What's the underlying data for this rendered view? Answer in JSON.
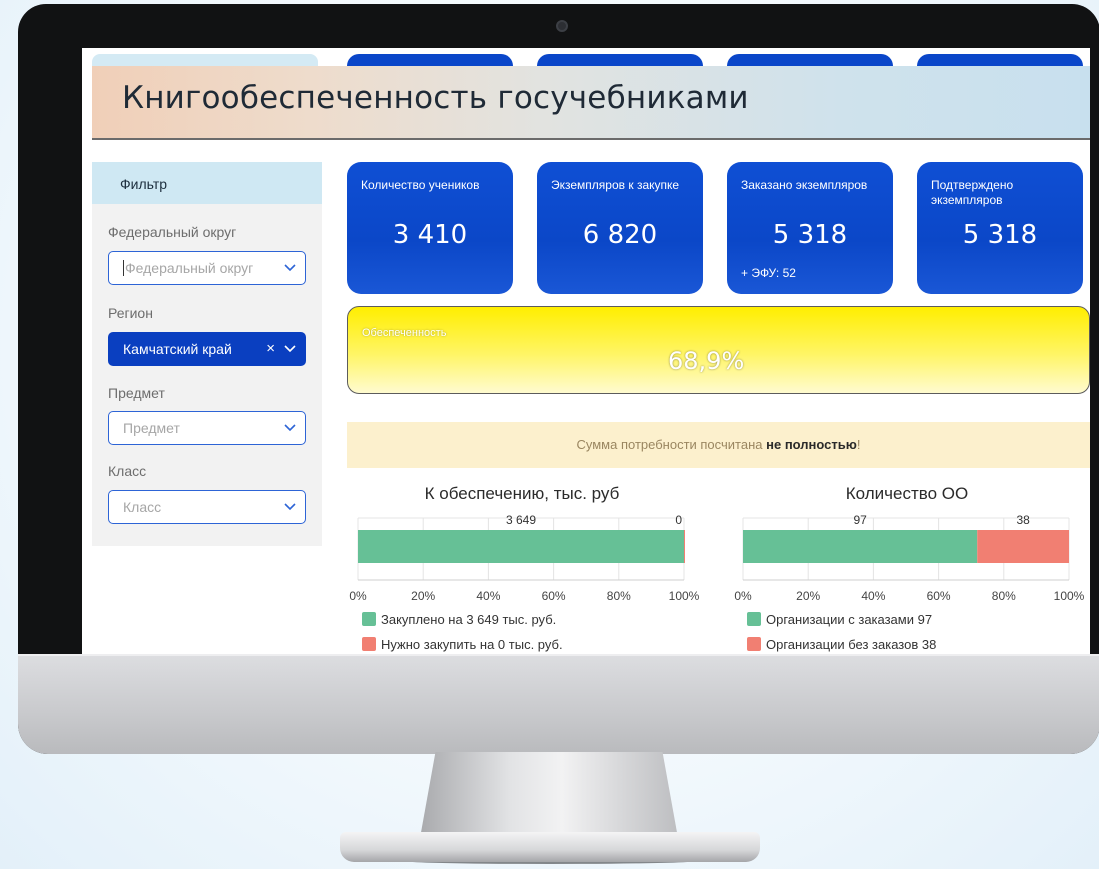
{
  "header": {
    "title": "Книгообеспеченность госучебниками"
  },
  "sidebar": {
    "title": "Фильтр",
    "filters": [
      {
        "label": "Федеральный округ",
        "placeholder": "Федеральный округ",
        "value": ""
      },
      {
        "label": "Регион",
        "placeholder": "",
        "value": "Камчатский край",
        "clear": "×"
      },
      {
        "label": "Предмет",
        "placeholder": "Предмет",
        "value": ""
      },
      {
        "label": "Класс",
        "placeholder": "Класс",
        "value": ""
      }
    ]
  },
  "kpis": [
    {
      "label": "Количество учеников",
      "value": "3 410"
    },
    {
      "label": "Экземпляров к закупке",
      "value": "6 820"
    },
    {
      "label": "Заказано экземпляров",
      "value": "5 318",
      "sub": "+ ЭФУ: 52"
    },
    {
      "label": "Подтверждено экземпляров",
      "value": "5 318"
    }
  ],
  "provision": {
    "label": "Обеспеченность",
    "value": "68,9%"
  },
  "notice": {
    "text": "Сумма потребности посчитана ",
    "bold": "не полностью",
    "tail": "!"
  },
  "colors": {
    "accent": "#0b47c8",
    "green": "#66c096",
    "red": "#f17f72",
    "yellow": "#ffee00"
  },
  "chart_data": [
    {
      "type": "bar",
      "stacked": "percent",
      "orientation": "horizontal",
      "title": "К обеспечению, тыс. руб",
      "xlim": [
        0,
        100
      ],
      "x_ticks": [
        "0%",
        "20%",
        "40%",
        "60%",
        "80%",
        "100%"
      ],
      "series": [
        {
          "name": "Закуплено на 3 649 тыс. руб.",
          "value": 3649,
          "label": "3 649",
          "color": "#66c096"
        },
        {
          "name": "Нужно закупить на 0 тыс. руб.",
          "value": 0,
          "label": "0",
          "color": "#f17f72"
        }
      ]
    },
    {
      "type": "bar",
      "stacked": "percent",
      "orientation": "horizontal",
      "title": "Количество ОО",
      "xlim": [
        0,
        100
      ],
      "x_ticks": [
        "0%",
        "20%",
        "40%",
        "60%",
        "80%",
        "100%"
      ],
      "series": [
        {
          "name": "Организации с заказами 97",
          "value": 97,
          "label": "97",
          "color": "#66c096"
        },
        {
          "name": "Организации без заказов 38",
          "value": 38,
          "label": "38",
          "color": "#f17f72"
        }
      ]
    }
  ]
}
